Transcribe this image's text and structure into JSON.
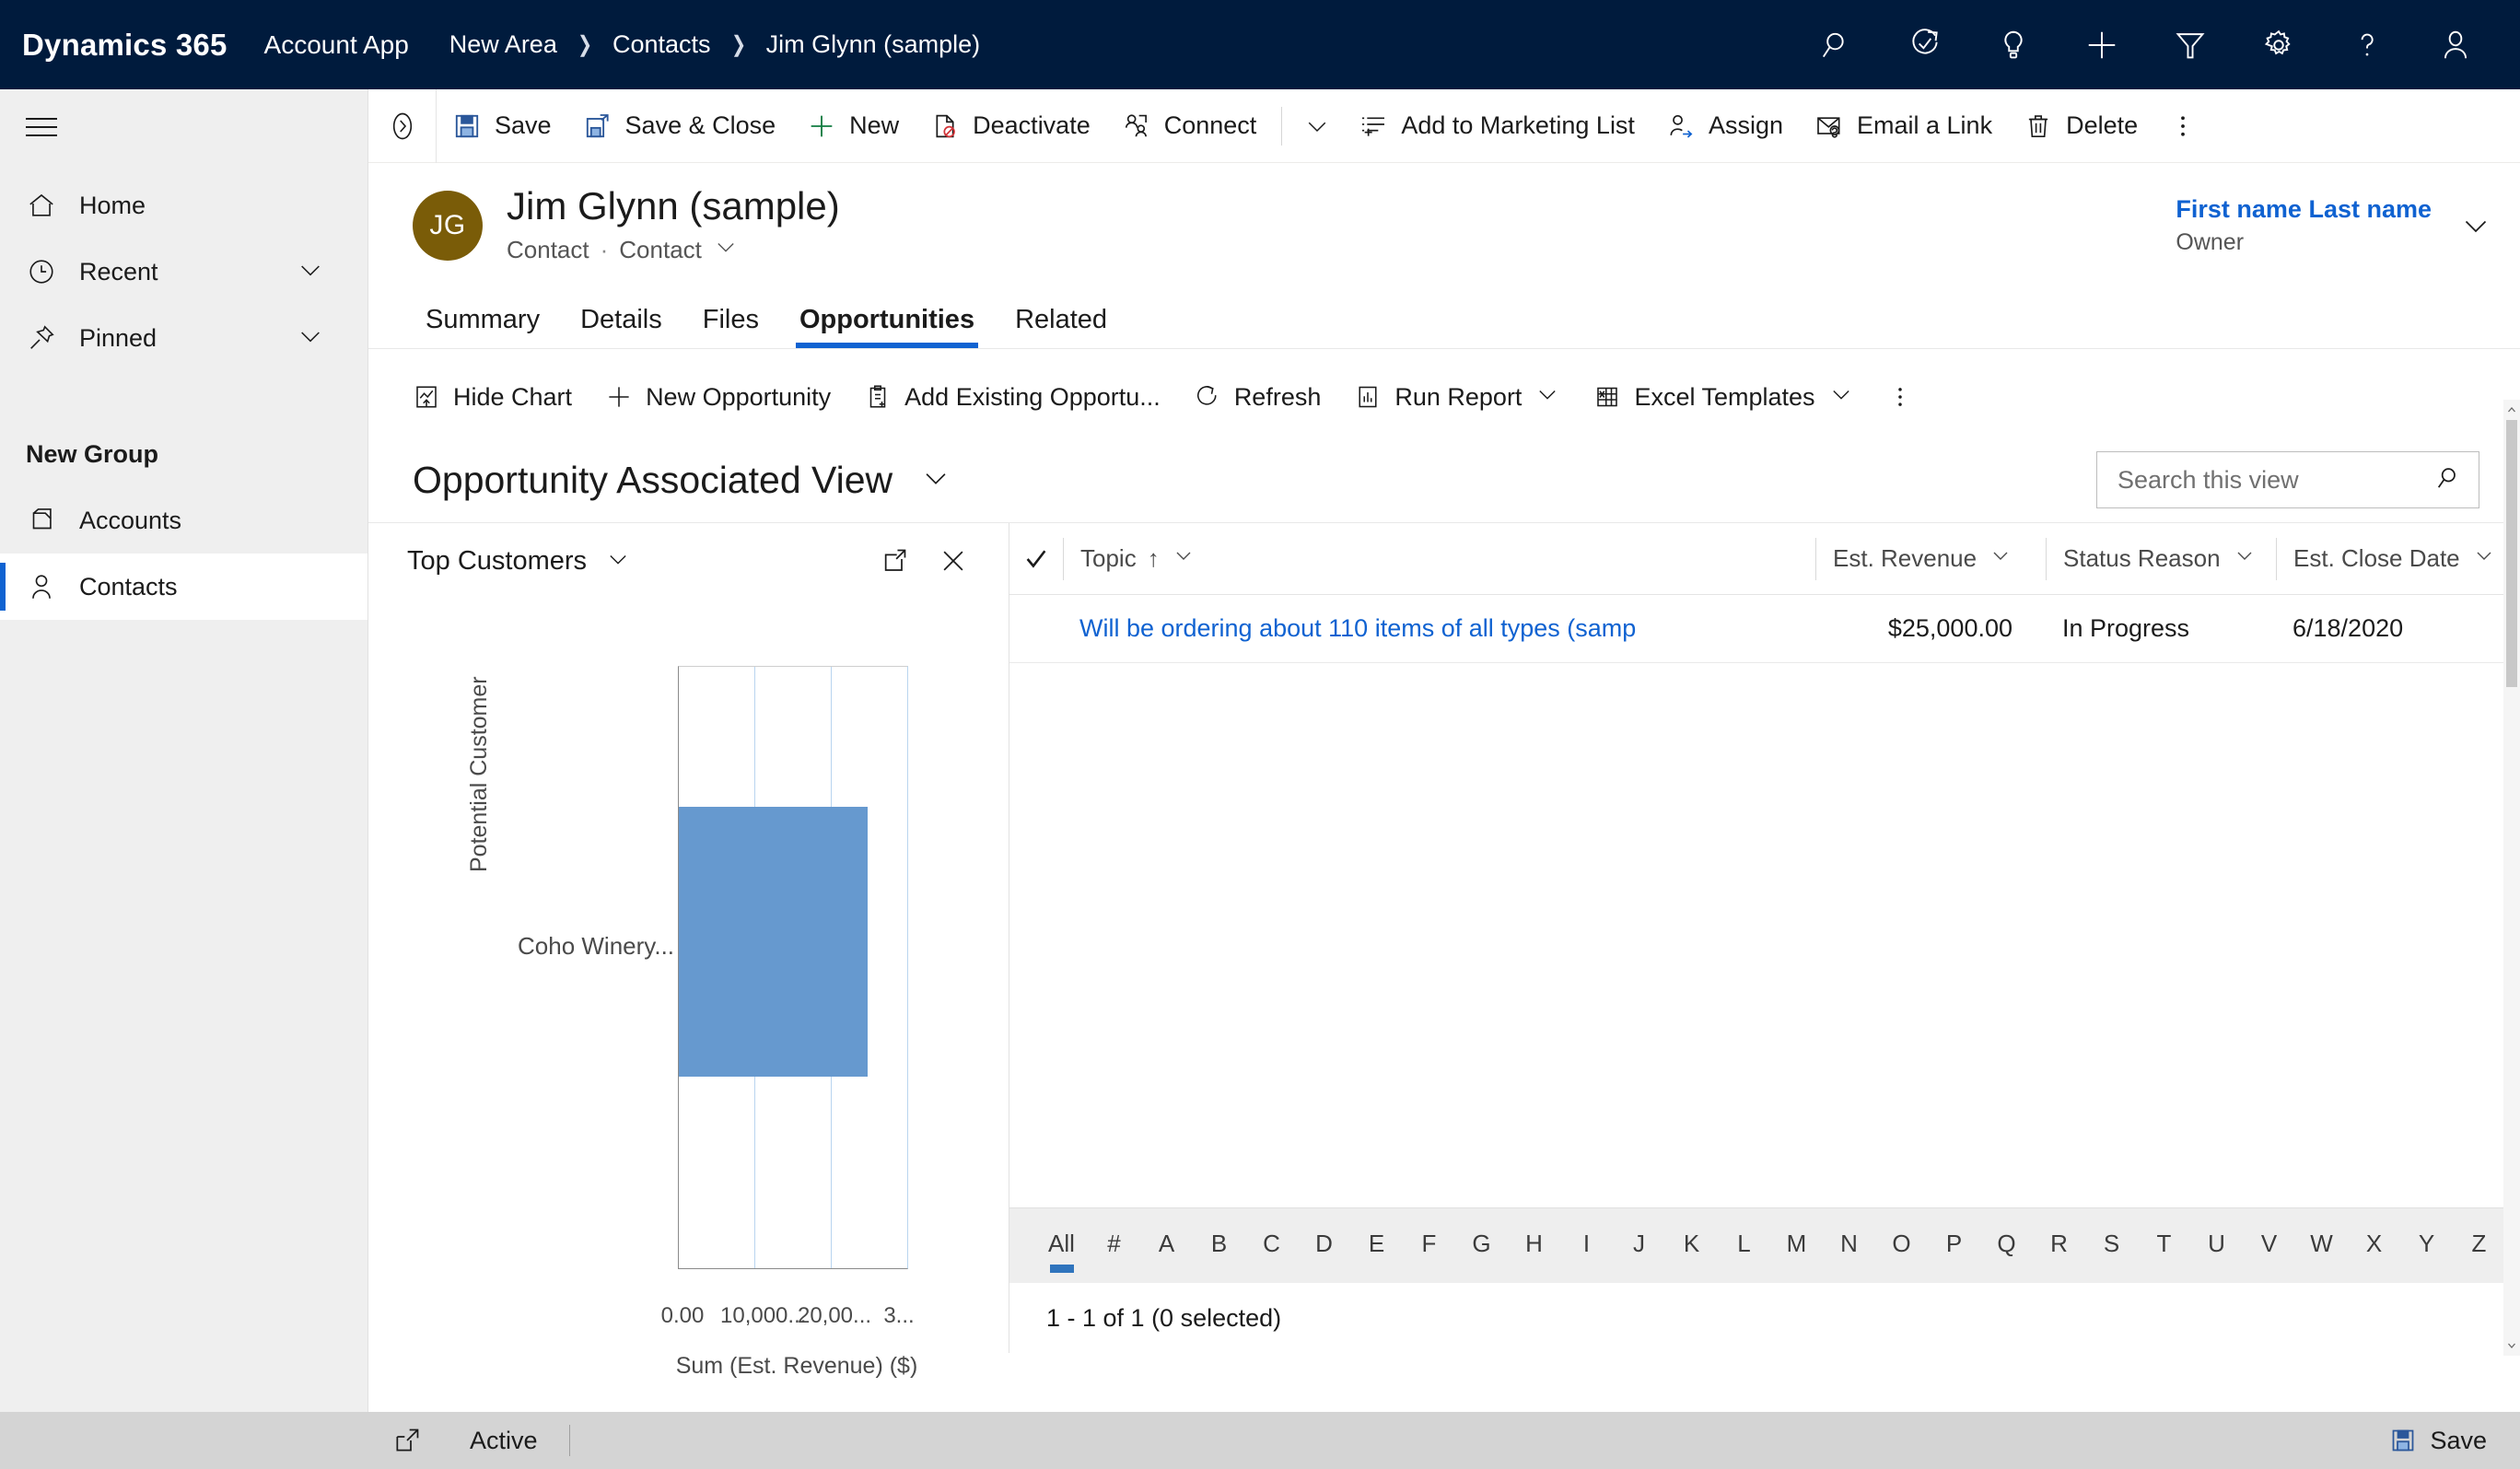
{
  "topbar": {
    "brand": "Dynamics 365",
    "app_name": "Account App",
    "breadcrumbs": [
      "New Area",
      "Contacts",
      "Jim Glynn (sample)"
    ],
    "icons": [
      "search-icon",
      "assistant-icon",
      "insights-icon",
      "quick-create-icon",
      "filter-icon",
      "settings-icon",
      "help-icon",
      "user-icon"
    ],
    "background": "#001b3d"
  },
  "sidebar": {
    "nav": [
      {
        "label": "Home",
        "icon": "home-icon",
        "chevron": false
      },
      {
        "label": "Recent",
        "icon": "clock-icon",
        "chevron": true
      },
      {
        "label": "Pinned",
        "icon": "pin-icon",
        "chevron": true
      }
    ],
    "group_title": "New Group",
    "group_items": [
      {
        "label": "Accounts",
        "icon": "accounts-icon",
        "selected": false
      },
      {
        "label": "Contacts",
        "icon": "contact-icon",
        "selected": true
      }
    ]
  },
  "commandbar": {
    "buttons": [
      {
        "label": "Save",
        "icon": "save-icon"
      },
      {
        "label": "Save & Close",
        "icon": "save-close-icon"
      },
      {
        "label": "New",
        "icon": "plus-icon"
      },
      {
        "label": "Deactivate",
        "icon": "deactivate-icon"
      },
      {
        "label": "Connect",
        "icon": "connect-icon"
      }
    ],
    "buttons2": [
      {
        "label": "Add to Marketing List",
        "icon": "marketing-list-icon"
      },
      {
        "label": "Assign",
        "icon": "assign-icon"
      },
      {
        "label": "Email a Link",
        "icon": "email-link-icon"
      },
      {
        "label": "Delete",
        "icon": "delete-icon"
      }
    ]
  },
  "record": {
    "initials": "JG",
    "avatar_color": "#7a5c08",
    "title": "Jim Glynn (sample)",
    "entity": "Contact",
    "form": "Contact",
    "owner_name": "First name Last name",
    "owner_role": "Owner"
  },
  "tabs": [
    {
      "label": "Summary",
      "active": false
    },
    {
      "label": "Details",
      "active": false
    },
    {
      "label": "Files",
      "active": false
    },
    {
      "label": "Opportunities",
      "active": true
    },
    {
      "label": "Related",
      "active": false
    }
  ],
  "subgrid_toolbar": [
    {
      "label": "Hide Chart",
      "icon": "chart-icon",
      "chevron": false
    },
    {
      "label": "New Opportunity",
      "icon": "plus-icon",
      "chevron": false
    },
    {
      "label": "Add Existing Opportu...",
      "icon": "add-existing-icon",
      "chevron": false
    },
    {
      "label": "Refresh",
      "icon": "refresh-icon",
      "chevron": false
    },
    {
      "label": "Run Report",
      "icon": "report-icon",
      "chevron": true
    },
    {
      "label": "Excel Templates",
      "icon": "excel-icon",
      "chevron": true
    }
  ],
  "view": {
    "title": "Opportunity Associated View",
    "search_placeholder": "Search this view"
  },
  "chart": {
    "title": "Top Customers",
    "expand_icon": "expand-icon",
    "close_icon": "close-icon"
  },
  "chart_data": {
    "type": "bar",
    "orientation": "horizontal",
    "title": "Top Customers",
    "categories": [
      "Coho Winery..."
    ],
    "values": [
      25000
    ],
    "xlabel": "Sum (Est. Revenue) ($)",
    "ylabel": "Potential Customer",
    "xticks": [
      "0.00",
      "10,000...",
      "20,00...",
      "3..."
    ],
    "xlim": [
      0,
      30000
    ],
    "bar_color": "#6699cf",
    "grid": true,
    "legend": false
  },
  "grid": {
    "columns": [
      {
        "label": "Topic",
        "sort": "↑",
        "chevron": true
      },
      {
        "label": "Est. Revenue",
        "sort": "",
        "chevron": true
      },
      {
        "label": "Status Reason",
        "sort": "",
        "chevron": true
      },
      {
        "label": "Est. Close Date",
        "sort": "",
        "chevron": true
      }
    ],
    "rows": [
      {
        "topic": "Will be ordering about 110 items of all types (samp",
        "est_revenue": "$25,000.00",
        "status_reason": "In Progress",
        "est_close_date": "6/18/2020"
      }
    ],
    "alphabet": [
      "All",
      "#",
      "A",
      "B",
      "C",
      "D",
      "E",
      "F",
      "G",
      "H",
      "I",
      "J",
      "K",
      "L",
      "M",
      "N",
      "O",
      "P",
      "Q",
      "R",
      "S",
      "T",
      "U",
      "V",
      "W",
      "X",
      "Y",
      "Z"
    ],
    "alphabet_selected": "All",
    "footer": "1 - 1 of 1 (0 selected)"
  },
  "statusbar": {
    "state": "Active",
    "save_label": "Save",
    "save_icon": "save-icon"
  }
}
